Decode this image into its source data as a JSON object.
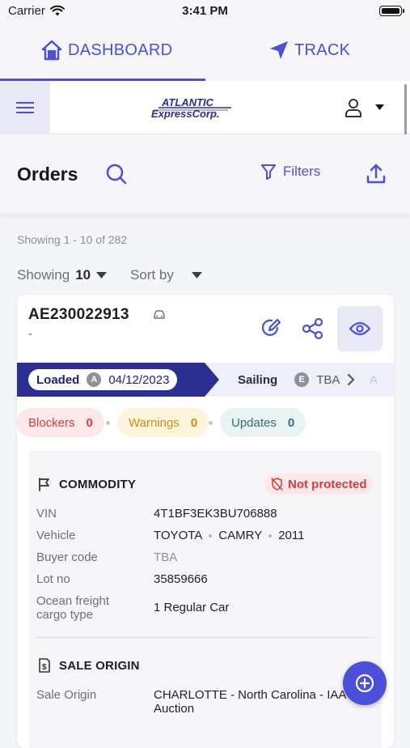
{
  "status_bar": {
    "carrier": "Carrier",
    "time": "3:41 PM"
  },
  "nav_tabs": {
    "dashboard": "DASHBOARD",
    "track": "TRACK",
    "active": "dashboard"
  },
  "header": {
    "logo_line1": "ATLANTIC",
    "logo_line2": "ExpressCorp."
  },
  "orders": {
    "title": "Orders",
    "filters_label": "Filters",
    "showing_range": "Showing 1 - 10 of 282",
    "page_size_label": "Showing",
    "page_size_value": "10",
    "sort_label": "Sort by"
  },
  "order_card": {
    "order_id": "AE230022913",
    "subtitle": "-",
    "timeline": {
      "current": {
        "label": "Loaded",
        "badge": "A",
        "date": "04/12/2023"
      },
      "next": {
        "label": "Sailing",
        "badge": "E",
        "value": "TBA"
      },
      "faded": "A"
    },
    "chips": [
      {
        "label": "Blockers",
        "count": "0"
      },
      {
        "label": "Warnings",
        "count": "0"
      },
      {
        "label": "Updates",
        "count": "0"
      }
    ],
    "commodity": {
      "heading": "COMMODITY",
      "protection_badge": "Not protected",
      "vin_label": "VIN",
      "vin": "4T1BF3EK3BU706888",
      "vehicle_label": "Vehicle",
      "vehicle_make": "TOYOTA",
      "vehicle_model": "CAMRY",
      "vehicle_year": "2011",
      "buyer_code_label": "Buyer code",
      "buyer_code": "TBA",
      "lot_no_label": "Lot no",
      "lot_no": "35859666",
      "cargo_type_label_1": "Ocean freight",
      "cargo_type_label_2": "cargo type",
      "cargo_type": "1 Regular Car"
    },
    "sale_origin": {
      "heading": "SALE ORIGIN",
      "label": "Sale Origin",
      "value_line1": "CHARLOTTE - North Carolina - IAA",
      "value_line2": "Auction"
    }
  },
  "colors": {
    "accent": "#4b4fd9",
    "timeline_active": "#2b2f91",
    "blockers": "#d63c3c",
    "warnings": "#c7920d",
    "updates": "#3a6c73"
  },
  "icons": [
    "wifi-icon",
    "battery-icon",
    "home-icon",
    "navigation-arrow-icon",
    "hamburger-menu-icon",
    "user-icon",
    "caret-down-icon",
    "search-icon",
    "filter-funnel-icon",
    "share-upload-icon",
    "car-icon",
    "edit-icon",
    "share-nodes-icon",
    "eye-icon",
    "chevron-right-icon",
    "flag-icon",
    "shield-off-icon",
    "dollar-document-icon",
    "plus-circle-icon"
  ]
}
